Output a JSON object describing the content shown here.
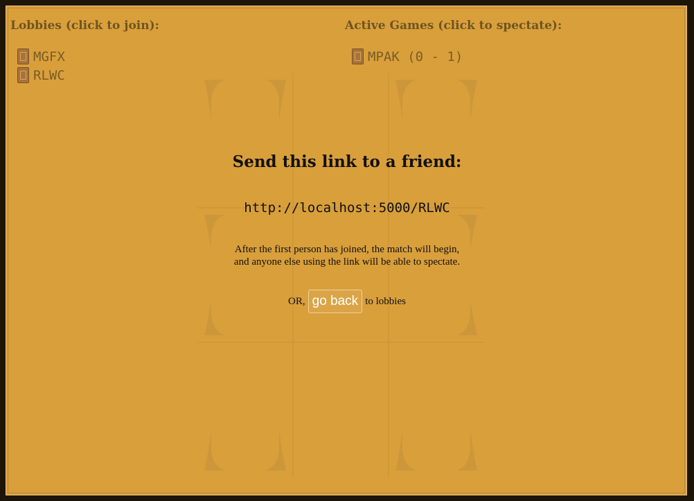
{
  "lobbies": {
    "title": "Lobbies (click to join):",
    "items": [
      {
        "code": "MGFX",
        "icon": "card-icon"
      },
      {
        "code": "RLWC",
        "icon": "card-icon"
      }
    ]
  },
  "active_games": {
    "title": "Active Games (click to spectate):",
    "items": [
      {
        "label": "MPAK (0 - 1)",
        "icon": "card-icon"
      }
    ]
  },
  "share": {
    "title": "Send this link to a friend:",
    "link": "http://localhost:5000/RLWC",
    "info_line1": "After the first person has joined, the match will begin,",
    "info_line2": "and anyone else using the link will be able to spectate.",
    "or_text": "OR,",
    "go_back_label": "go back",
    "to_lobbies_text": "to lobbies"
  },
  "colors": {
    "background": "#d99f3b",
    "outer": "#1e1509",
    "heading_text": "#6e5520",
    "button_text": "#ffffff"
  }
}
